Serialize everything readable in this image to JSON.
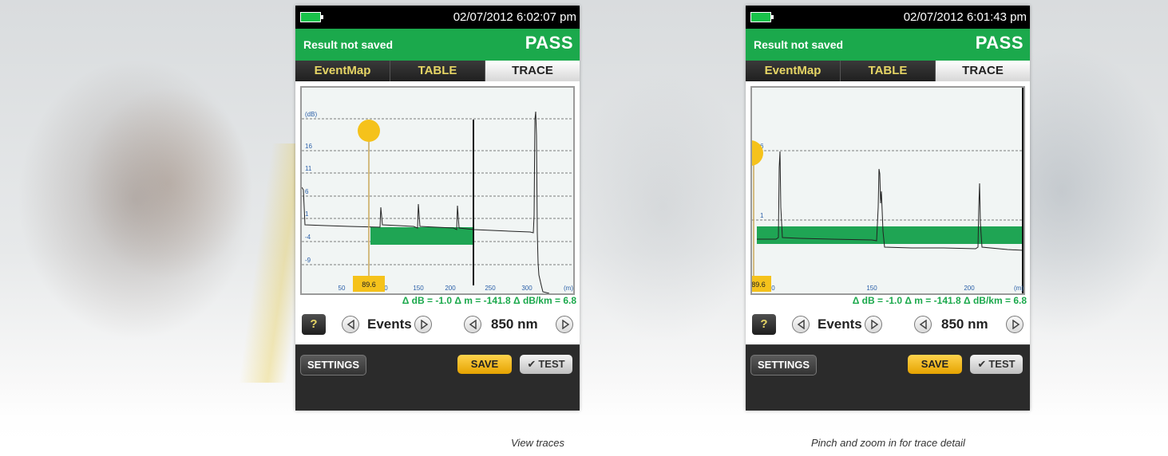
{
  "captions": {
    "left": "View traces",
    "right": "Pinch and zoom in for trace detail"
  },
  "colors": {
    "result_green": "#1ba94c",
    "tab_yellow": "#e6d565",
    "save_yellow": "#ffd34d",
    "cursor_yellow": "#f5c21b"
  },
  "screens": [
    {
      "datetime": "02/07/2012 6:02:07 pm",
      "result_status": "Result not saved",
      "verdict": "PASS",
      "tabs": [
        {
          "label": "EventMap",
          "active": false
        },
        {
          "label": "TABLE",
          "active": false
        },
        {
          "label": "TRACE",
          "active": true
        }
      ],
      "chart_data": {
        "type": "line",
        "y_unit_label": "(dB)",
        "x_unit_label": "(m)",
        "y_ticks": [
          16,
          11,
          6,
          1,
          -4,
          -9
        ],
        "x_ticks": [
          50,
          100,
          150,
          200,
          250,
          300
        ],
        "cursor_value": "89.6",
        "x_range": [
          0,
          350
        ],
        "y_range": [
          -16,
          22
        ]
      },
      "readout": "Δ dB = -1.0  Δ m = -141.8  Δ dB/km = 6.8",
      "controls": {
        "events_label": "Events",
        "wavelength_label": "850 nm",
        "help_label": "?"
      },
      "buttons": {
        "settings": "SETTINGS",
        "save": "SAVE",
        "test": "TEST"
      }
    },
    {
      "datetime": "02/07/2012 6:01:43 pm",
      "result_status": "Result not saved",
      "verdict": "PASS",
      "tabs": [
        {
          "label": "EventMap",
          "active": false
        },
        {
          "label": "TABLE",
          "active": false
        },
        {
          "label": "TRACE",
          "active": true
        }
      ],
      "chart_data": {
        "type": "line",
        "x_unit_label": "(m)",
        "y_ticks": [
          6,
          1
        ],
        "x_ticks": [
          100,
          150,
          200
        ],
        "cursor_value": "89.6",
        "x_range": [
          88,
          230
        ],
        "y_range": [
          -8,
          12
        ]
      },
      "readout": "Δ dB = -1.0  Δ m = -141.8  Δ dB/km = 6.8",
      "controls": {
        "events_label": "Events",
        "wavelength_label": "850 nm",
        "help_label": "?"
      },
      "buttons": {
        "settings": "SETTINGS",
        "save": "SAVE",
        "test": "TEST"
      }
    }
  ]
}
